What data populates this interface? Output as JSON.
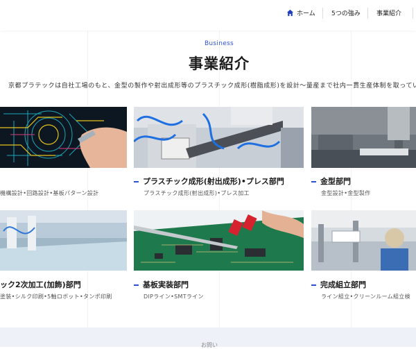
{
  "nav": {
    "items": [
      {
        "label": "ホーム",
        "icon": "home-icon"
      },
      {
        "label": "5つの強み"
      },
      {
        "label": "事業紹介"
      }
    ]
  },
  "section": {
    "eyebrow": "Business",
    "title": "事業紹介",
    "lead": "京都プラテックは自社工場のもと、金型の製作や射出成形等のプラスチック成形(樹脂成形)を設計〜量産まで社内一貫生産体制を取っていま"
  },
  "cards": [
    {
      "title": "",
      "sub": "機構設計•回路設計•基板パターン設計",
      "image": "design-cad-photo"
    },
    {
      "title": "プラスチック成形(射出成形)•プレス部門",
      "sub": "プラスチック成形(射出成形)•プレス加工",
      "image": "injection-molding-photo"
    },
    {
      "title": "金型部門",
      "sub": "金型設計•金型製作",
      "image": "mold-machining-photo"
    },
    {
      "title": "ック2次加工(加飾)部門",
      "sub": "塗装•シルク印刷•5軸ロボット•タンポ印刷",
      "image": "secondary-processing-photo"
    },
    {
      "title": "基板実装部門",
      "sub": "DIPライン•SMTライン",
      "image": "pcb-assembly-photo"
    },
    {
      "title": "完成組立部門",
      "sub": "ライン組立•クリーンルーム組立検",
      "image": "assembly-line-photo"
    }
  ],
  "colors": {
    "accent": "#2d4fd6",
    "footer": "#eef1f7"
  },
  "footer": {
    "peek": "お問い"
  }
}
